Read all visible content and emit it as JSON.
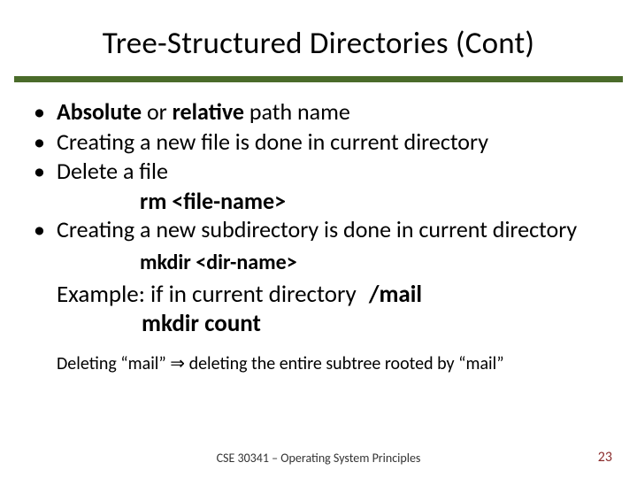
{
  "title": "Tree-Structured Directories (Cont)",
  "bullets": {
    "b1_bold1": "Absolute",
    "b1_mid": " or ",
    "b1_bold2": "relative",
    "b1_tail": " path name",
    "b2": "Creating a new file is done in current directory",
    "b3": "Delete a file",
    "cmd_rm": "rm <file-name>",
    "b4": "Creating a new subdirectory is done in current directory",
    "cmd_mkdir": "mkdir <dir-name>"
  },
  "example_label": "Example:  if in current directory  ",
  "example_dir": "/mail",
  "example_cmd": "mkdir count",
  "deleting_pre": "Deleting “mail” ",
  "deleting_arrow": "⇒",
  "deleting_post": " deleting the entire subtree rooted by “mail”",
  "footer": "CSE 30341 – Operating System Principles",
  "page": "23"
}
